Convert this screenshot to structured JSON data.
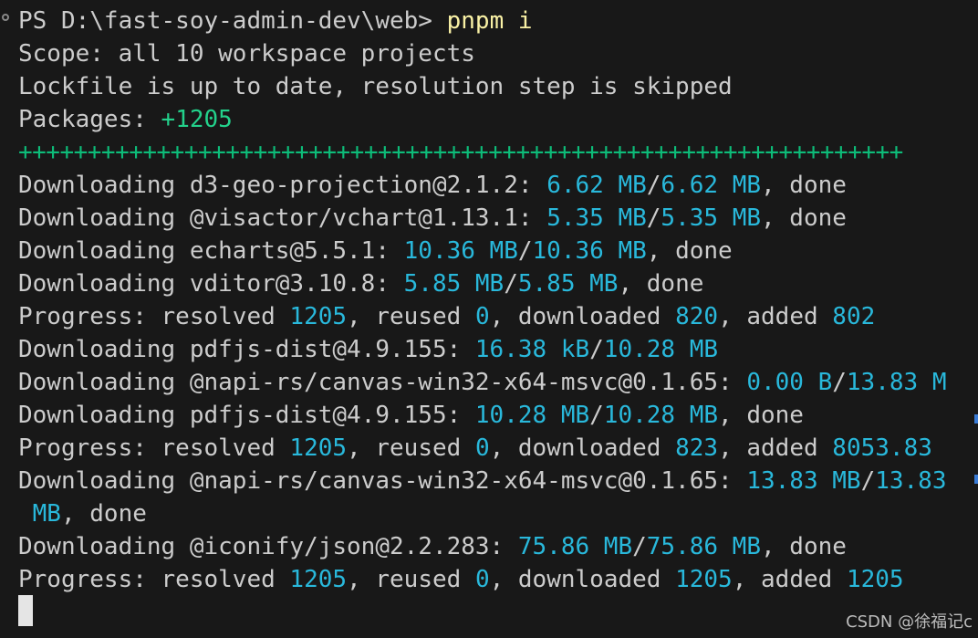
{
  "terminal": {
    "prompt": "PS D:\\fast-soy-admin-dev\\web> ",
    "command": "pnpm i",
    "scope": "Scope: all 10 workspace projects",
    "lockfile": "Lockfile is up to date, resolution step is skipped",
    "packages_label": "Packages: ",
    "packages_value": "+1205",
    "progress_bar": "++++++++++++++++++++++++++++++++++++++++++++++++++++++++++++++++",
    "dl1": {
      "label": "Downloading d3-geo-projection@2.1.2: ",
      "a": "6.62 MB",
      "sep": "/",
      "b": "6.62 MB",
      "tail": ", done"
    },
    "dl2": {
      "label": "Downloading @visactor/vchart@1.13.1: ",
      "a": "5.35 MB",
      "sep": "/",
      "b": "5.35 MB",
      "tail": ", done"
    },
    "dl3": {
      "label": "Downloading echarts@5.5.1: ",
      "a": "10.36 MB",
      "sep": "/",
      "b": "10.36 MB",
      "tail": ", done"
    },
    "dl4": {
      "label": "Downloading vditor@3.10.8: ",
      "a": "5.85 MB",
      "sep": "/",
      "b": "5.85 MB",
      "tail": ", done"
    },
    "prog1": {
      "l1": "Progress: resolved ",
      "v1": "1205",
      "l2": ", reused ",
      "v2": "0",
      "l3": ", downloaded ",
      "v3": "820",
      "l4": ", added ",
      "v4": "802"
    },
    "dl5": {
      "label": "Downloading pdfjs-dist@4.9.155: ",
      "a": "16.38 kB",
      "sep": "/",
      "b": "10.28 MB"
    },
    "dl6": {
      "label": "Downloading @napi-rs/canvas-win32-x64-msvc@0.1.65: ",
      "a": "0.00 B",
      "sep": "/",
      "b": "13.83 M"
    },
    "dl7": {
      "label": "Downloading pdfjs-dist@4.9.155: ",
      "a": "10.28 MB",
      "sep": "/",
      "b": "10.28 MB",
      "tail": ", done"
    },
    "prog2": {
      "l1": "Progress: resolved ",
      "v1": "1205",
      "l2": ", reused ",
      "v2": "0",
      "l3": ", downloaded ",
      "v3": "823",
      "l4": ", added ",
      "v4": "8053.83"
    },
    "dl8": {
      "label": "Downloading @napi-rs/canvas-win32-x64-msvc@0.1.65: ",
      "a": "13.83 MB",
      "sep": "/",
      "b": "13.83"
    },
    "dl8_wrap": {
      "a": " MB",
      "tail": ", done"
    },
    "dl9": {
      "label": "Downloading @iconify/json@2.2.283: ",
      "a": "75.86 MB",
      "sep": "/",
      "b": "75.86 MB",
      "tail": ", done"
    },
    "prog3": {
      "l1": "Progress: resolved ",
      "v1": "1205",
      "l2": ", reused ",
      "v2": "0",
      "l3": ", downloaded ",
      "v3": "1205",
      "l4": ", added ",
      "v4": "1205"
    }
  },
  "watermark": "CSDN @徐福记c",
  "colors": {
    "background": "#181818",
    "text": "#cccccc",
    "command": "#f9f1a5",
    "number": "#29b8db",
    "success": "#23d18b"
  }
}
